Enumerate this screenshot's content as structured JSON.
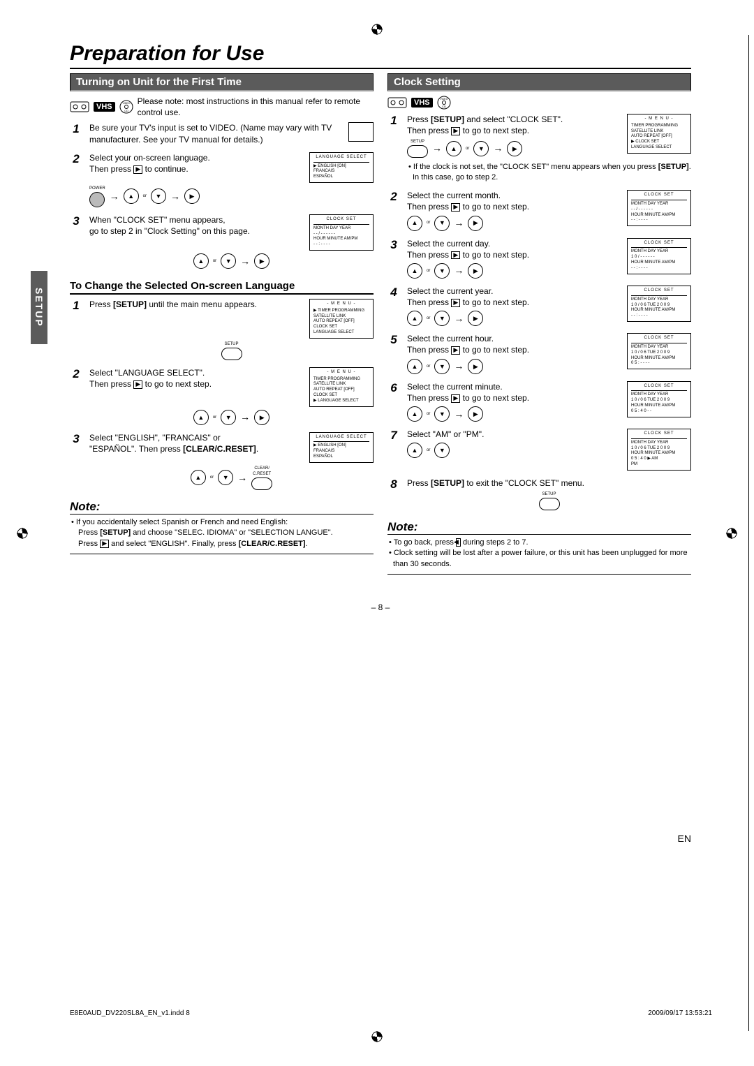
{
  "page": {
    "title": "Preparation for Use",
    "side_tab": "SETUP",
    "page_number": "– 8 –",
    "lang_code": "EN",
    "footer_left": "E8E0AUD_DV220SL8A_EN_v1.indd   8",
    "footer_right": "2009/09/17   13:53:21"
  },
  "left": {
    "section1_header": "Turning on Unit for the First Time",
    "vhs_label": "VHS",
    "vhs_note": "Please note: most instructions in this manual refer to remote control use.",
    "steps": [
      {
        "num": "1",
        "text": "Be sure your TV's input is set to VIDEO. (Name may vary with TV manufacturer. See your TV manual for details.)"
      },
      {
        "num": "2",
        "text_a": "Select your on-screen language.",
        "text_b": "Then press [▶] to continue."
      },
      {
        "num": "3",
        "text_a": "When \"CLOCK SET\" menu appears,",
        "text_b": "go to step 2 in \"Clock Setting\" on this page."
      }
    ],
    "power_label": "POWER",
    "or": "or",
    "screen_lang": {
      "title": "LANGUAGE SELECT",
      "lines": [
        "▶ ENGLISH            [ON]",
        "   FRANCAIS",
        "   ESPAÑOL"
      ]
    },
    "screen_clockset": {
      "title": "CLOCK SET",
      "row1": "MONTH   DAY         YEAR",
      "row1v": "- -  /  - -         - - - -",
      "row2": "HOUR   MINUTE       AM/PM",
      "row2v": "- -  :  - -         - -"
    },
    "subheader": "To Change the Selected On-screen Language",
    "lang_steps": [
      {
        "num": "1",
        "text": "Press [SETUP] until the main menu appears."
      },
      {
        "num": "2",
        "text_a": "Select \"LANGUAGE SELECT\".",
        "text_b": "Then press [▶] to go to next step."
      },
      {
        "num": "3",
        "text_a": "Select \"ENGLISH\", \"FRANCAIS\" or",
        "text_b": "\"ESPAÑOL\". Then press [CLEAR/C.RESET]."
      }
    ],
    "setup_label": "SETUP",
    "clear_label": "CLEAR/\nC.RESET",
    "screen_menu": {
      "title": "- M E N U -",
      "lines": [
        "▶ TIMER PROGRAMMING",
        "   SATELLITE LINK",
        "   AUTO REPEAT     [OFF]",
        "   CLOCK SET",
        "   LANGUAGE SELECT"
      ]
    },
    "screen_menu2": {
      "title": "- M E N U -",
      "lines": [
        "   TIMER PROGRAMMING",
        "   SATELLITE LINK",
        "   AUTO REPEAT     [OFF]",
        "   CLOCK SET",
        "▶ LANGUAGE SELECT"
      ]
    },
    "note_header": "Note:",
    "note_bullet": "• If you accidentally select Spanish or French and need English:",
    "note_line1": "Press [SETUP] and choose \"SELEC. IDIOMA\" or \"SELECTION LANGUE\".",
    "note_line2": "Press [▶] and select \"ENGLISH\". Finally, press [CLEAR/C.RESET]."
  },
  "right": {
    "section_header": "Clock Setting",
    "vhs_label": "VHS",
    "steps": [
      {
        "num": "1",
        "text_a": "Press [SETUP] and select \"CLOCK SET\".",
        "text_b": "Then press [▶] to go to next step."
      },
      {
        "num": "2",
        "text_a": "Select the current month.",
        "text_b": "Then press [▶] to go to next step."
      },
      {
        "num": "3",
        "text_a": "Select the current day.",
        "text_b": "Then press [▶] to go to next step."
      },
      {
        "num": "4",
        "text_a": "Select the current year.",
        "text_b": "Then press [▶] to go to next step."
      },
      {
        "num": "5",
        "text_a": "Select the current hour.",
        "text_b": "Then press [▶] to go to next step."
      },
      {
        "num": "6",
        "text_a": "Select the current minute.",
        "text_b": "Then press [▶] to go to next step."
      },
      {
        "num": "7",
        "text_a": "Select \"AM\" or \"PM\"."
      },
      {
        "num": "8",
        "text_a": "Press [SETUP] to exit the \"CLOCK SET\" menu."
      }
    ],
    "setup_label": "SETUP",
    "or": "or",
    "sub_bullet": "• If the clock is not set, the \"CLOCK SET\" menu appears when you press [SETUP]. In this case, go to step 2.",
    "screens": {
      "menu": {
        "title": "- M E N U -",
        "lines": [
          "   TIMER PROGRAMMING",
          "   SATELLITE LINK",
          "   AUTO REPEAT     [OFF]",
          "▶ CLOCK SET",
          "   LANGUAGE SELECT"
        ]
      },
      "cs2": {
        "row1v": "MONTH   DAY         YEAR",
        "row1d": "- -  /  - -         - - - -",
        "row2v": "HOUR   MINUTE       AM/PM",
        "row2d": "- -  :  - -         - -"
      },
      "cs3": {
        "row1d": " 1 0  /  - -         - - - -",
        "row2d": "- -  :  - -         - -"
      },
      "cs4": {
        "row1d": " 1 0  /  0 6  TUE   2 0 0 9",
        "row2d": "- -  :  - -         - -"
      },
      "cs5": {
        "row1d": " 1 0  /  0 6  TUE   2 0 0 9",
        "row2d": " 0 5  :  - -         - -"
      },
      "cs6": {
        "row1d": " 1 0  /  0 6  TUE   2 0 0 9",
        "row2d": " 0 5  :  4 0         - -"
      },
      "cs7": {
        "row1d": " 1 0  /  0 6  TUE   2 0 0 9",
        "row2d": " 0 5  :  4 0       ▶ AM",
        "row3d": "                       PM"
      }
    },
    "clockset_title": "CLOCK SET",
    "clockset_row1": "MONTH   DAY         YEAR",
    "clockset_row2": "HOUR   MINUTE       AM/PM",
    "note_header": "Note:",
    "note_b1": "• To go back, press [◀] during steps 2 to 7.",
    "note_b2": "• Clock setting will be lost after a power failure, or this unit has been unplugged for more than 30 seconds."
  }
}
